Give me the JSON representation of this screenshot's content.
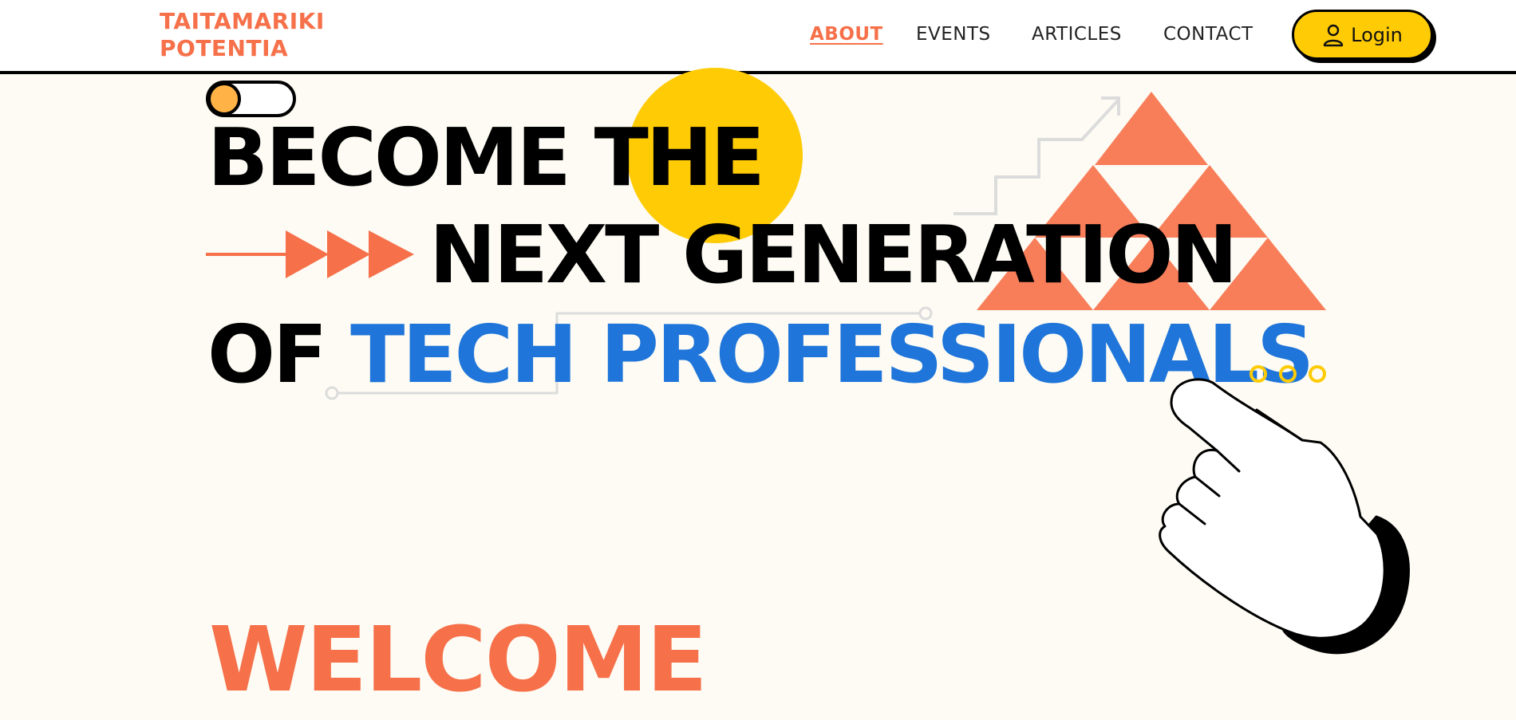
{
  "header": {
    "logo_line1": "TAITAMARIKI",
    "logo_line2": "POTENTIA",
    "nav": {
      "about": "ABOUT",
      "events": "EVENTS",
      "articles": "ARTICLES",
      "contact": "CONTACT"
    },
    "login_label": "Login",
    "login_icon": "user-icon"
  },
  "hero": {
    "line1": "BECOME THE",
    "line2": "NEXT GENERATION",
    "line3_prefix": "OF",
    "line3_highlight1": "TECH",
    "line3_highlight2": "PROFESSIONALS",
    "welcome": "WELCOME"
  },
  "colors": {
    "accent_orange": "#f6704a",
    "accent_yellow": "#ffcb05",
    "accent_blue": "#1f75d9",
    "background": "#fdfbf3"
  },
  "decorations": [
    "toggle-switch",
    "yellow-circle",
    "triangle-pyramid",
    "arrow-chevrons",
    "stair-arrow",
    "circuit-line",
    "ellipsis-dots",
    "pointing-hand"
  ]
}
